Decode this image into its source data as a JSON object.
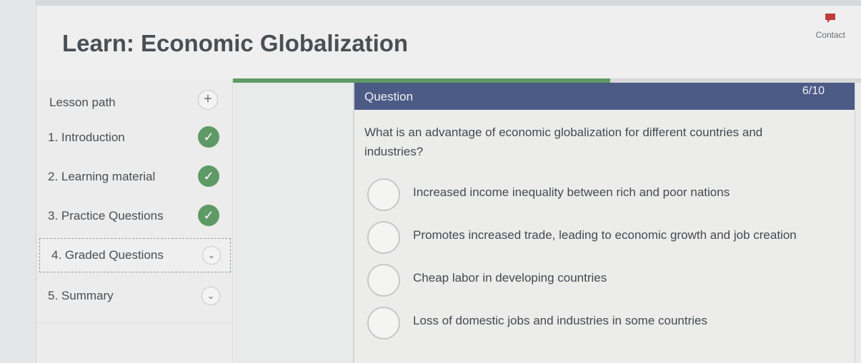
{
  "header": {
    "title": "Learn: Economic Globalization",
    "contact_label": "Contact",
    "contact_icon": "chat-bubble-icon"
  },
  "sidebar": {
    "heading": "Lesson path",
    "add_icon": "plus-icon",
    "items": [
      {
        "label": "1. Introduction",
        "status": "completed"
      },
      {
        "label": "2. Learning material",
        "status": "completed"
      },
      {
        "label": "3. Practice Questions",
        "status": "completed"
      },
      {
        "label": "4. Graded Questions",
        "status": "current"
      },
      {
        "label": "5. Summary",
        "status": "locked"
      }
    ]
  },
  "question": {
    "label": "Question",
    "counter": "6/10",
    "progress": 0.6,
    "text": "What is an advantage of economic globalization for different countries and industries?",
    "options": [
      "Increased income inequality between rich and poor nations",
      "Promotes increased trade, leading to economic growth and job creation",
      "Cheap labor in developing countries",
      "Loss of domestic jobs and industries in some countries"
    ]
  },
  "colors": {
    "accent": "#4c5b85",
    "success": "#5f9a66"
  }
}
